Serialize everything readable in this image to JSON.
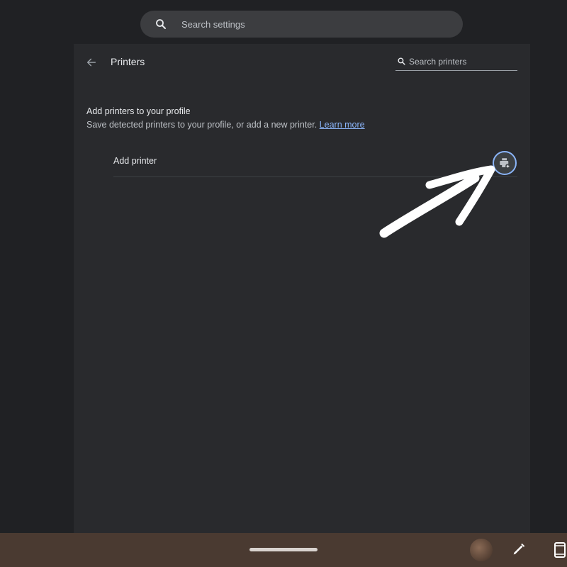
{
  "top_search": {
    "placeholder": "Search settings",
    "icon": "search-icon"
  },
  "header": {
    "title": "Printers",
    "back_icon": "arrow-back-icon",
    "search_placeholder": "Search printers",
    "search_icon": "search-icon"
  },
  "section": {
    "heading": "Add printers to your profile",
    "description": "Save detected printers to your profile, or add a new printer.",
    "link_label": "Learn more"
  },
  "add_printer": {
    "label": "Add printer",
    "icon": "add-printer-icon"
  },
  "shelf": {
    "icons": [
      "home-bar",
      "avatar",
      "stylus-icon",
      "tablet-mode-icon"
    ]
  },
  "colors": {
    "page_bg": "#202124",
    "panel_bg": "#292a2d",
    "accent": "#8ab4f8",
    "shelf_bg": "#4a3a31"
  }
}
